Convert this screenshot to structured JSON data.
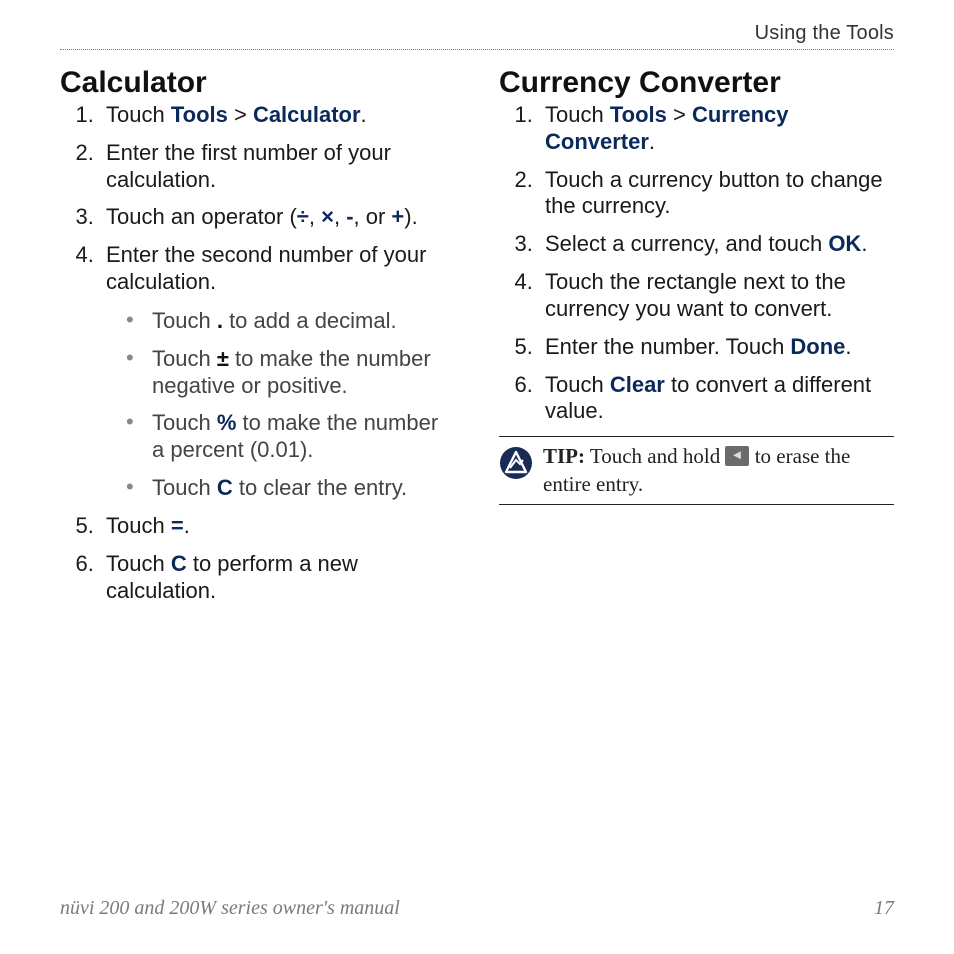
{
  "header": {
    "section": "Using the Tools"
  },
  "left": {
    "title": "Calculator",
    "s1": {
      "t1": "Touch ",
      "b1": "Tools",
      "sep": " > ",
      "b2": "Calculator",
      "t2": "."
    },
    "s2": "Enter the first number of your calculation.",
    "s3": {
      "t1": "Touch an operator (",
      "op1": "÷",
      "c1": ", ",
      "op2": "×",
      "c2": ", ",
      "op3": "-",
      "c3": ", or ",
      "op4": "+",
      "t2": ")."
    },
    "s4": "Enter the second number of your calculation.",
    "sub": {
      "a": {
        "t1": "Touch ",
        "k": ".",
        "t2": " to add a decimal."
      },
      "b": {
        "t1": "Touch ",
        "k": "±",
        "t2": " to make the number negative or positive."
      },
      "c": {
        "t1": "Touch ",
        "k": "%",
        "t2": " to make the number a percent (0.01)."
      },
      "d": {
        "t1": "Touch ",
        "k": "C",
        "t2": " to clear the entry."
      }
    },
    "s5": {
      "t1": "Touch ",
      "k": "=",
      "t2": "."
    },
    "s6": {
      "t1": "Touch ",
      "k": "C",
      "t2": " to perform a new calculation."
    }
  },
  "right": {
    "title": "Currency Converter",
    "s1": {
      "t1": "Touch ",
      "b1": "Tools",
      "sep": " > ",
      "b2": "Currency Converter",
      "t2": "."
    },
    "s2": "Touch a currency button to change the currency.",
    "s3": {
      "t1": "Select a currency, and touch ",
      "b": "OK",
      "t2": "."
    },
    "s4": "Touch the rectangle next to the currency you want to convert.",
    "s5": {
      "t1": "Enter the number. Touch ",
      "b": "Done",
      "t2": "."
    },
    "s6": {
      "t1": "Touch ",
      "b": "Clear",
      "t2": " to convert a different value."
    },
    "tip": {
      "label": "TIP:",
      "t1": " Touch and hold ",
      "t2": " to erase the entire entry."
    }
  },
  "footer": {
    "manual": "nüvi 200 and 200W series owner's manual",
    "page": "17"
  }
}
